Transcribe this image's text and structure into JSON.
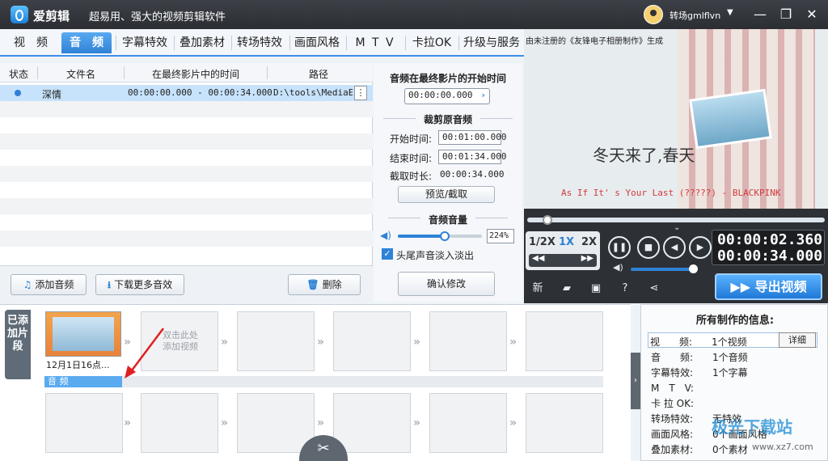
{
  "app": {
    "name": "爱剪辑",
    "slogan": "超易用、强大的视频剪辑软件",
    "user": "转场gmlflvn"
  },
  "tabs": [
    {
      "label": "视　频"
    },
    {
      "label": "音　频"
    },
    {
      "label": "字幕特效"
    },
    {
      "label": "叠加素材"
    },
    {
      "label": "转场特效"
    },
    {
      "label": "画面风格"
    },
    {
      "label": "M T V"
    },
    {
      "label": "卡拉OK"
    },
    {
      "label": "升级与服务"
    }
  ],
  "audio_table": {
    "headers": [
      "状态",
      "文件名",
      "在最终影片中的时间",
      "路径"
    ],
    "rows": [
      {
        "name": "深情",
        "time": "00:00:00.000 - 00:00:34.000",
        "path": "D:\\tools\\MediaE..."
      }
    ],
    "add_label": "添加音频",
    "download_label": "下载更多音效",
    "delete_label": "删除"
  },
  "settings": {
    "start_title": "音频在最终影片的开始时间",
    "start_value": "00:00:00.000",
    "trim_title": "裁剪原音频",
    "start_time_label": "开始时间:",
    "start_time_value": "00:01:00.000",
    "end_time_label": "结束时间:",
    "end_time_value": "00:01:34.000",
    "duration_label": "截取时长:",
    "duration_value": "00:00:34.000",
    "preview_label": "预览/截取",
    "volume_title": "音频音量",
    "volume_value": "224%",
    "fade_label": "头尾声音淡入淡出",
    "fade_checked": true,
    "confirm_label": "确认修改"
  },
  "preview": {
    "header": "由未注册的《友锋电子相册制作》生成",
    "caption": "冬天来了,春天",
    "song": "As If It' s Your Last (?????) - BLACKPINK"
  },
  "player": {
    "speeds": [
      "1/2X",
      "1X",
      "2X"
    ],
    "active_speed": "1X",
    "current_time": "00:00:02.360",
    "total_time": "00:00:34.000",
    "export_label": "导出视频"
  },
  "timeline": {
    "side_label": "已添加片段",
    "clip_label": "12月1日16点...",
    "placeholder": "双击此处\n添加视频",
    "audio_track_label": "音 频"
  },
  "info": {
    "title": "所有制作的信息:",
    "rows": [
      {
        "key": "视　　频:",
        "value": "1个视频"
      },
      {
        "key": "音　　频:",
        "value": "1个音频"
      },
      {
        "key": "字幕特效:",
        "value": "1个字幕"
      },
      {
        "key": "M　T　V:",
        "value": ""
      },
      {
        "key": "卡 拉 OK:",
        "value": ""
      },
      {
        "key": "转场特效:",
        "value": "无特效"
      },
      {
        "key": "画面风格:",
        "value": "0个画面风格"
      },
      {
        "key": "叠加素材:",
        "value": "0个素材"
      }
    ],
    "detail_label": "详细"
  },
  "watermark": {
    "text": "极光下载站",
    "sub": "www.xz7.com"
  }
}
